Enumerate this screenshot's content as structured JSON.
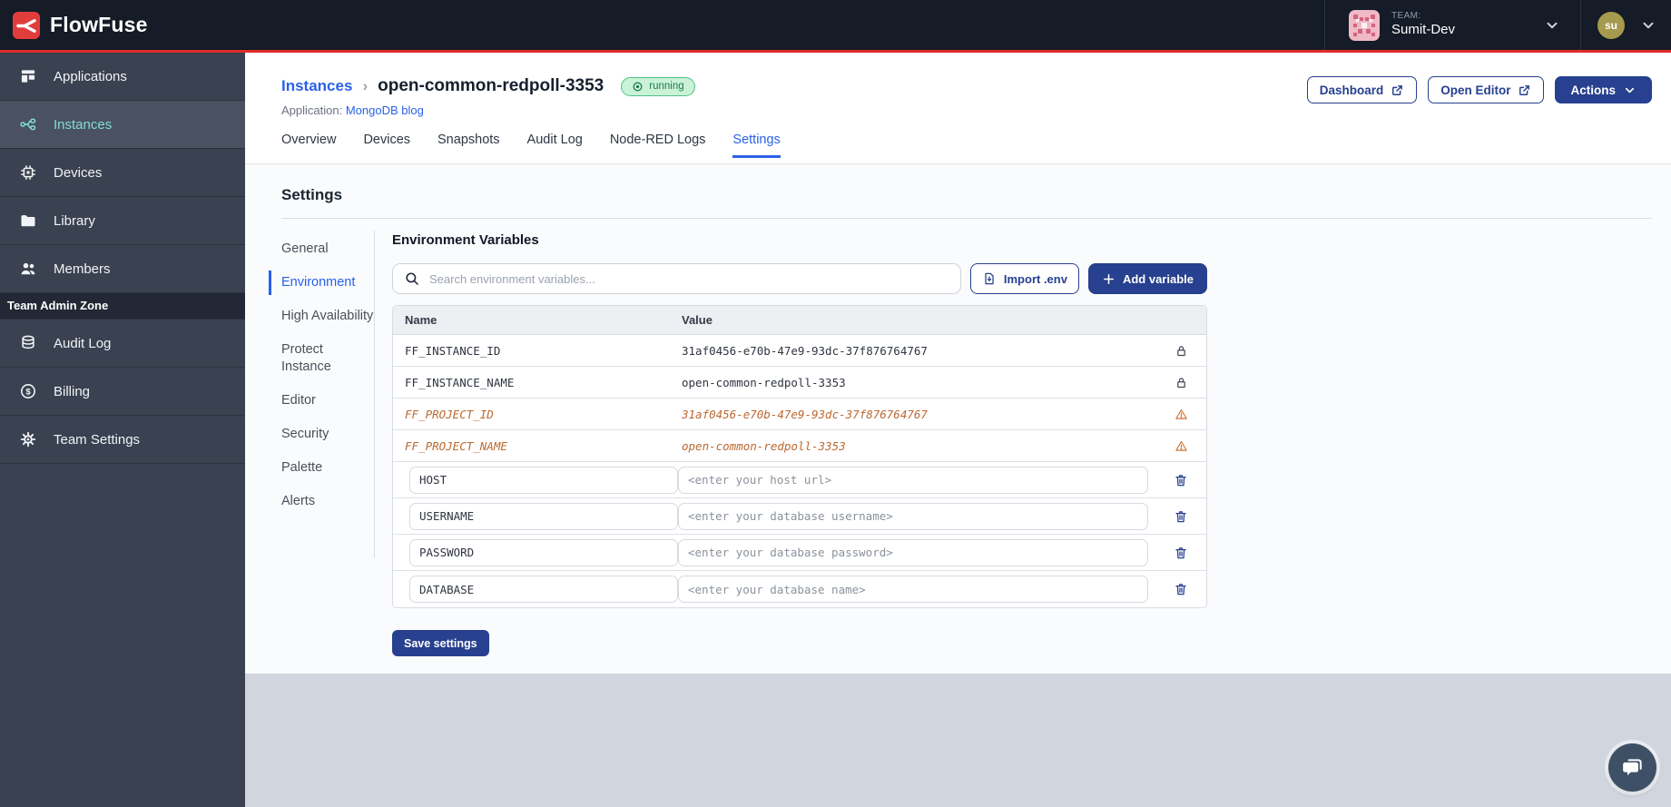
{
  "navbar": {
    "brand": "FlowFuse",
    "team": {
      "label": "TEAM:",
      "name": "Sumit-Dev"
    },
    "user": {
      "initials": "su"
    }
  },
  "sidebar": {
    "items": [
      {
        "label": "Applications"
      },
      {
        "label": "Instances"
      },
      {
        "label": "Devices"
      },
      {
        "label": "Library"
      },
      {
        "label": "Members"
      }
    ],
    "section_label": "Team Admin Zone",
    "admin_items": [
      {
        "label": "Audit Log"
      },
      {
        "label": "Billing"
      },
      {
        "label": "Team Settings"
      }
    ]
  },
  "header": {
    "breadcrumb": {
      "root": "Instances",
      "separator": "›",
      "current": "open-common-redpoll-3353"
    },
    "status_badge": "running",
    "application": {
      "label": "Application:",
      "name": "MongoDB blog"
    },
    "actions": {
      "dashboard": "Dashboard",
      "open_editor": "Open Editor",
      "actions_menu": "Actions"
    }
  },
  "tabs": [
    {
      "label": "Overview"
    },
    {
      "label": "Devices"
    },
    {
      "label": "Snapshots"
    },
    {
      "label": "Audit Log"
    },
    {
      "label": "Node-RED Logs"
    },
    {
      "label": "Settings"
    }
  ],
  "settings": {
    "title": "Settings",
    "nav": [
      {
        "label": "General"
      },
      {
        "label": "Environment"
      },
      {
        "label": "High Availability"
      },
      {
        "label": "Protect Instance"
      },
      {
        "label": "Editor"
      },
      {
        "label": "Security"
      },
      {
        "label": "Palette"
      },
      {
        "label": "Alerts"
      }
    ],
    "panel": {
      "title": "Environment Variables",
      "search_placeholder": "Search environment variables...",
      "import_button": "Import .env",
      "add_button": "Add variable",
      "table": {
        "columns": [
          {
            "label": "Name"
          },
          {
            "label": "Value"
          }
        ],
        "locked_rows": [
          {
            "name": "FF_INSTANCE_ID",
            "value": "31af0456-e70b-47e9-93dc-37f876764767"
          },
          {
            "name": "FF_INSTANCE_NAME",
            "value": "open-common-redpoll-3353"
          }
        ],
        "deprecated_rows": [
          {
            "name": "FF_PROJECT_ID",
            "value": "31af0456-e70b-47e9-93dc-37f876764767"
          },
          {
            "name": "FF_PROJECT_NAME",
            "value": "open-common-redpoll-3353"
          }
        ],
        "editable_rows": [
          {
            "name": "HOST",
            "value_placeholder": "<enter your host url>"
          },
          {
            "name": "USERNAME",
            "value_placeholder": "<enter your database username>"
          },
          {
            "name": "PASSWORD",
            "value_placeholder": "<enter your database password>"
          },
          {
            "name": "DATABASE",
            "value_placeholder": "<enter your database name>"
          }
        ]
      },
      "save_button": "Save settings"
    }
  },
  "colors": {
    "brand_red": "#e23d3d",
    "navbar_bg": "#151b27",
    "sidebar_bg": "#3a4150",
    "sidebar_active_teal": "#84dcd4",
    "accent_blue": "#2962e8",
    "primary_navy": "#27408f",
    "status_running_bg": "#c9f2d6",
    "status_running_text": "#1d7a4e",
    "deprecated_orange": "#bb6831",
    "footer_gray": "#d1d5dd"
  }
}
